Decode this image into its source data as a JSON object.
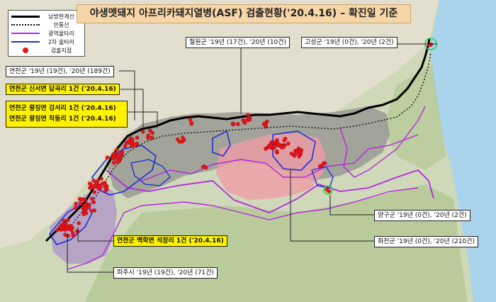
{
  "title": "야생멧돼지 아프리카돼지열병(ASF) 검출현황('20.4.16) – 확진일 기준",
  "legend": {
    "items": [
      {
        "label": "남방한계선",
        "symbol": "solid-black-line"
      },
      {
        "label": "민통선",
        "symbol": "dotted-black-line"
      },
      {
        "label": "광역울타리",
        "symbol": "purple-line"
      },
      {
        "label": "2차 울타리",
        "symbol": "blue-line"
      },
      {
        "label": "검출지점",
        "symbol": "red-dot"
      }
    ]
  },
  "callouts": {
    "cheorwon": "철원군 '19년 (17건), '20년 (10건)",
    "goseong": "고성군 '19년 (0건), '20년 (2건)",
    "yeoncheon": "연천군 '19년 (19건), '20년 (189건)",
    "yeoncheon_sinseo": "연천군 신서면 답곡리 1건 ('20.4.16)",
    "yeoncheon_wangjing_gangseo": "연천군 왕징면 강서리 1건 ('20.4.16)",
    "yeoncheon_wangjing_jakdong": "연천군 왕징면 작동리 1건 ('20.4.16)",
    "yeoncheon_baekhak": "연천군 백학면 석장리 1건 ('20.4.16)",
    "paju": "파주시 '19년 (19건), '20년 (71건)",
    "yanggu": "양구군 '19년 (0건), '20년 (2건)",
    "hwacheon": "화천군 '19년 (0건), '20년 (210건)"
  },
  "colors": {
    "sea": "#a9d4ec",
    "land": "#cfd9b9",
    "forest": "#b4c794",
    "north_land": "#e3dfcf",
    "grey_zone": "#9a9a94",
    "pink_zone": "#ef9ca6",
    "purple_zone": "#b29ac7",
    "south_limit_line": "#000000",
    "purple_fence": "#b327e0",
    "blue_fence": "#1f2fd6",
    "detection_point": "#e8161c",
    "callout_highlight": "#fff200",
    "title_bg": "#f6d6a8"
  }
}
